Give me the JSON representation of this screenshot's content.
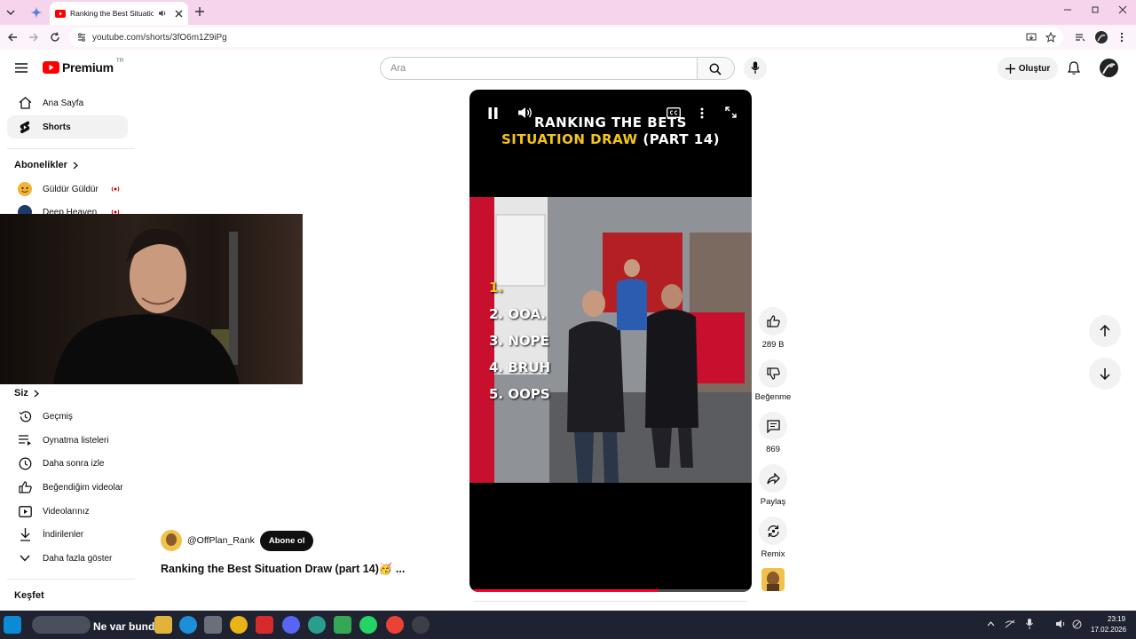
{
  "browser": {
    "tab_title": "Ranking the Best Situation",
    "url": "youtube.com/shorts/3fO6m1Z9iPg"
  },
  "header": {
    "logo_text": "Premium",
    "region_badge": "TR",
    "search_placeholder": "Ara",
    "create_label": "Oluştur"
  },
  "sidebar": {
    "items": [
      {
        "label": "Ana Sayfa",
        "icon": "home-icon"
      },
      {
        "label": "Shorts",
        "icon": "shorts-icon"
      }
    ],
    "subscriptions_heading": "Abonelikler",
    "subscriptions": [
      {
        "label": "Güldür Güldür"
      },
      {
        "label": "Deep Heaven"
      }
    ],
    "you_heading": "Siz",
    "you_items": [
      {
        "label": "Geçmiş",
        "icon": "history-icon"
      },
      {
        "label": "Oynatma listeleri",
        "icon": "playlist-icon"
      },
      {
        "label": "Daha sonra izle",
        "icon": "watch-later-icon"
      },
      {
        "label": "Beğendiğim videolar",
        "icon": "thumbs-up-icon"
      },
      {
        "label": "Videolarınız",
        "icon": "your-videos-icon"
      },
      {
        "label": "İndirilenler",
        "icon": "download-icon"
      },
      {
        "label": "Daha fazla göster",
        "icon": "chevron-down-icon"
      }
    ],
    "explore_heading": "Keşfet"
  },
  "video": {
    "overlay_title_line1": "RANKING THE BETS",
    "overlay_title_line2_a": "SITUATION DRAW",
    "overlay_title_line2_b": "(PART 14)",
    "ranks": [
      "1.",
      "2. OOA.",
      "3. NOPE",
      "4. BRUH",
      "5. OOPS"
    ],
    "progress": 0.67
  },
  "actions": {
    "likes": "289 B",
    "dislike_label": "Beğenme",
    "comments": "869",
    "share_label": "Paylaş",
    "remix_label": "Remix"
  },
  "channel": {
    "handle": "@OffPlan_Rank",
    "subscribe_label": "Abone ol",
    "title": "Ranking the Best Situation Draw (part 14)🥳 ..."
  },
  "taskbar": {
    "stream_text": "Ne var bunda",
    "clock_time": "23:19",
    "clock_date": "17.02.2026"
  },
  "colors": {
    "accent_red": "#ff0033",
    "title_yellow": "#f5c518",
    "tab_bar": "#f6d5ec"
  }
}
